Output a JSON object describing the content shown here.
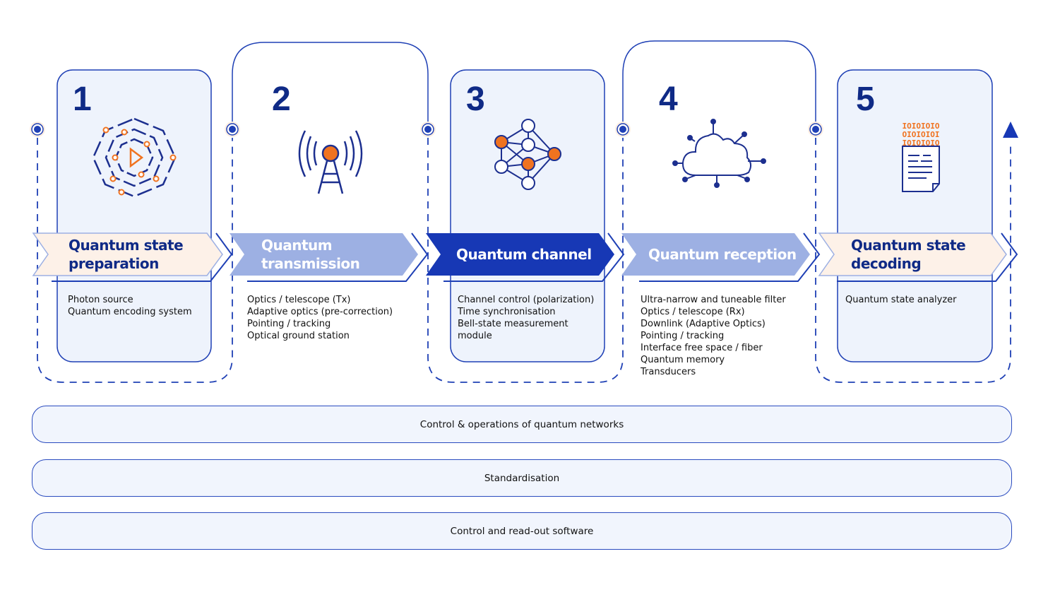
{
  "stages": [
    {
      "number": "1",
      "title_lines": [
        "Quantum state",
        "preparation"
      ],
      "icon": "atom-orbit-play-icon",
      "items": [
        "Photon source",
        "Quantum encoding system"
      ]
    },
    {
      "number": "2",
      "title_lines": [
        "Quantum",
        "transmission"
      ],
      "icon": "antenna-tower-icon",
      "items": [
        "Optics / telescope (Tx)",
        "Adaptive optics (pre-correction)",
        "Pointing / tracking",
        "Optical ground station"
      ]
    },
    {
      "number": "3",
      "title_lines": [
        "Quantum channel"
      ],
      "icon": "network-nodes-icon",
      "items": [
        "Channel control (polarization)",
        "Time synchronisation",
        "Bell-state measurement",
        "module"
      ]
    },
    {
      "number": "4",
      "title_lines": [
        "Quantum reception"
      ],
      "icon": "cloud-network-icon",
      "items": [
        "Ultra-narrow and tuneable filter",
        "Optics / telescope (Rx)",
        "Downlink (Adaptive Optics)",
        "Pointing / tracking",
        "Interface free space / fiber",
        "Quantum memory",
        "Transducers"
      ]
    },
    {
      "number": "5",
      "title_lines": [
        "Quantum state",
        "decoding"
      ],
      "icon": "binary-document-icon",
      "binary": [
        "IOIOIOIO",
        "OIOIOIOI",
        "IOIOIOIO"
      ],
      "items": [
        "Quantum state analyzer"
      ]
    }
  ],
  "layers": [
    "Control & operations of quantum networks",
    "Standardisation",
    "Control and read-out software"
  ],
  "colors": {
    "navy": "#0f2a86",
    "blue": "#1738b5",
    "light_blue": "#9db0e3",
    "peach": "#fdf1e8",
    "card": "#eef3fc",
    "orange": "#f07320"
  }
}
